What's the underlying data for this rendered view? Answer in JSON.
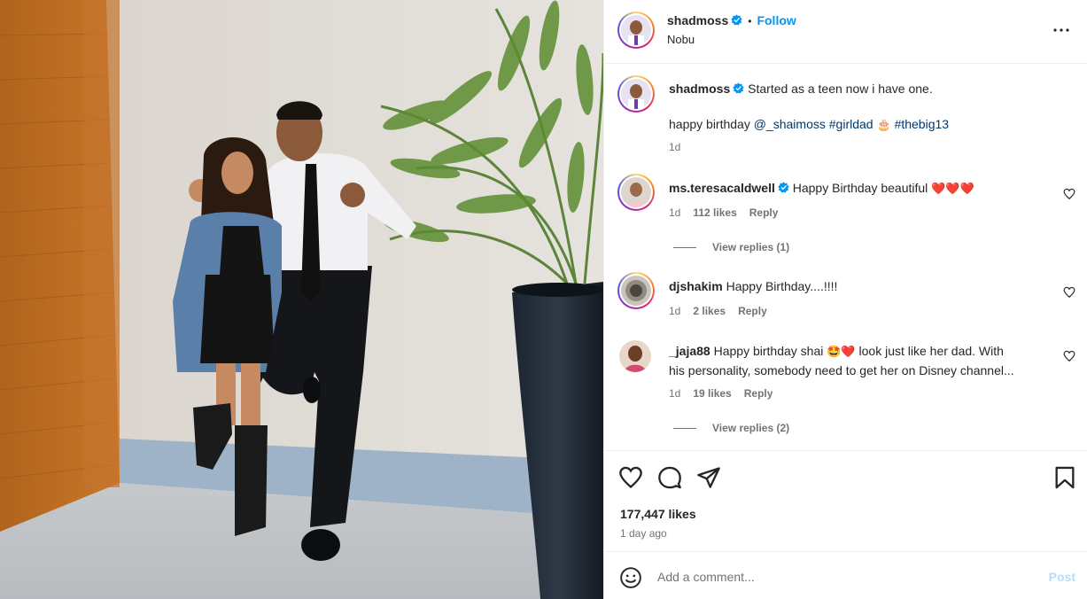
{
  "post": {
    "author": "shadmoss",
    "follow_label": "Follow",
    "separator": "•",
    "location": "Nobu",
    "more_icon": "more-horizontal-icon"
  },
  "caption": {
    "author": "shadmoss",
    "line1": "Started as a teen now i have one.",
    "line2_prefix": "happy birthday ",
    "mention": "@_shaimoss",
    "hashtag1": "#girldad",
    "cake_emoji": "🎂",
    "hashtag2": "#thebig13",
    "time": "1d"
  },
  "comments": [
    {
      "user": "ms.teresacaldwell",
      "verified": true,
      "text": "Happy Birthday beautiful",
      "hearts": "❤️❤️❤️",
      "time": "1d",
      "likes": "112 likes",
      "reply": "Reply",
      "view_replies": "View replies (1)"
    },
    {
      "user": "djshakim",
      "verified": false,
      "text": "Happy Birthday....!!!!",
      "time": "1d",
      "likes": "2 likes",
      "reply": "Reply"
    },
    {
      "user": "_jaja88",
      "verified": false,
      "text_part1": "Happy birthday shai",
      "emojis": "🤩❤️",
      "text_part2": "look just like her dad. With",
      "text_line2": "his personality, somebody need to get her on Disney channel...",
      "time": "1d",
      "likes": "19 likes",
      "reply": "Reply",
      "view_replies": "View replies (2)"
    }
  ],
  "engagement": {
    "likes": "177,447 likes",
    "time_ago": "1 day ago"
  },
  "add_comment": {
    "placeholder": "Add a comment...",
    "post_label": "Post"
  },
  "colors": {
    "accent": "#0095f6",
    "link": "#00376b",
    "muted": "#737373",
    "post_disabled": "#b2dffc",
    "heart_red": "#ed4956"
  }
}
